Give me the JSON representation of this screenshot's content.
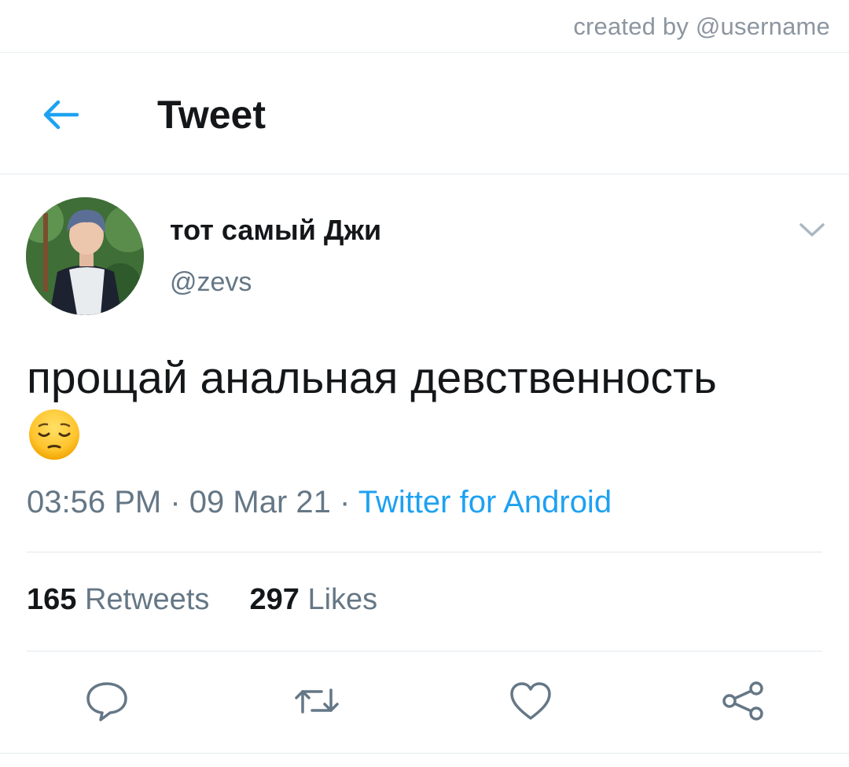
{
  "watermark": "created by @username",
  "header": {
    "title": "Tweet",
    "back_icon": "arrow-left-icon"
  },
  "author": {
    "name": "тот самый Джи",
    "handle": "@zevs"
  },
  "tweet": {
    "text": "прощай анальная девственность",
    "emoji": "pensive-face"
  },
  "meta": {
    "time": "03:56 PM",
    "separator": " · ",
    "date": "09 Mar 21",
    "source": "Twitter for Android"
  },
  "stats": {
    "retweets_count": "165",
    "retweets_label": "Retweets",
    "likes_count": "297",
    "likes_label": "Likes"
  },
  "actions": [
    "reply-icon",
    "retweet-icon",
    "like-icon",
    "share-icon"
  ],
  "colors": {
    "accent": "#1da1f2",
    "secondary_text": "#657786",
    "primary_text": "#14171a",
    "icon": "#657786"
  }
}
